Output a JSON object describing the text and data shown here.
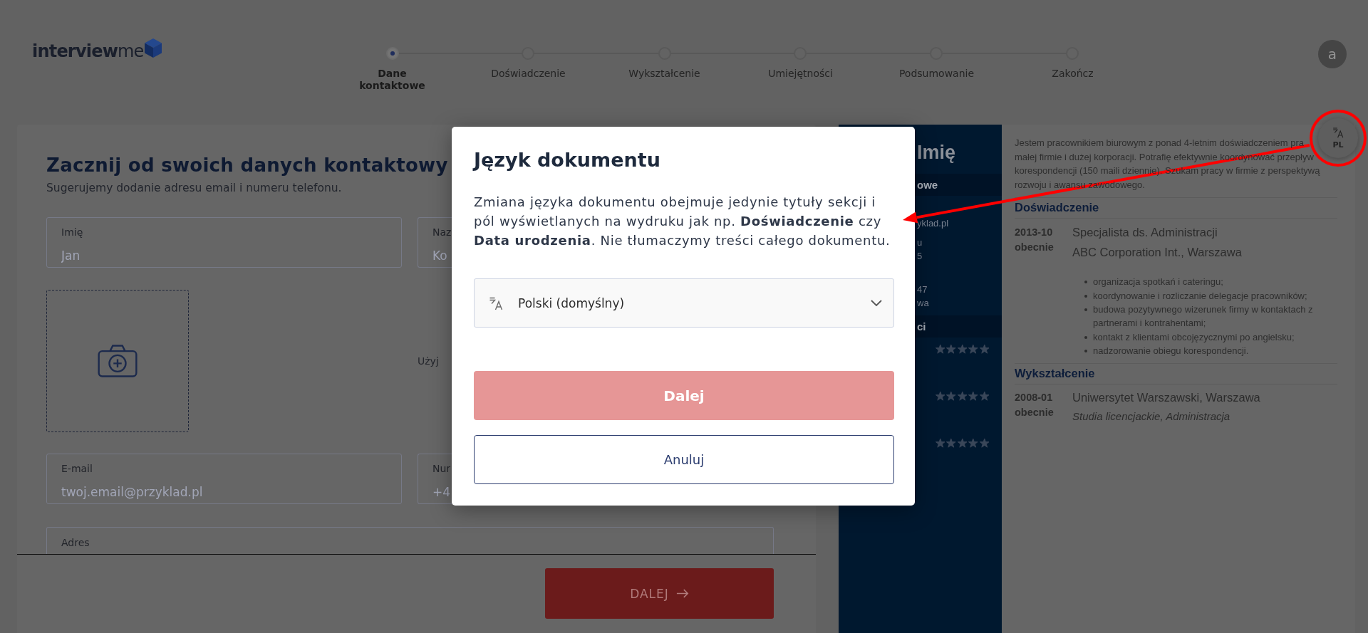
{
  "header": {
    "logo": "**interview**me",
    "steps": [
      {
        "label": "Dane kontaktowe",
        "selected": true
      },
      {
        "label": "Doświadczenie",
        "selected": false
      },
      {
        "label": "Wykształcenie",
        "selected": false
      },
      {
        "label": "Umiejętności",
        "selected": false
      },
      {
        "label": "Podsumowanie",
        "selected": false
      },
      {
        "label": "Zakończ",
        "selected": false
      }
    ],
    "avatar": "a"
  },
  "form": {
    "title": "Zacznij od swoich danych kontaktowy",
    "subtitle": "Sugerujemy dodanie adresu email i numeru telefonu.",
    "name_fields": [
      {
        "label": "Imię",
        "placeholder": "Jan"
      },
      {
        "label": "Naz",
        "placeholder": "Ko"
      }
    ],
    "photo_hint": "Użyj",
    "contact_fields": [
      {
        "label": "E-mail",
        "placeholder": "twoj.email@przyklad.pl"
      },
      {
        "label": "Nur",
        "placeholder": "+4"
      }
    ],
    "address_field": {
      "label": "Adres"
    },
    "next_button": {
      "label": "DALEJ"
    }
  },
  "cv_preview": {
    "sidebar": {
      "name": "Imię",
      "contact_heading": "owe",
      "contact_groups": [
        [
          "yklad.pl"
        ],
        [
          "u",
          "5"
        ],
        [
          "47",
          "wa"
        ]
      ],
      "skills_heading": "ci",
      "skills": [
        {
          "stars": 5
        },
        {
          "stars": 5
        },
        {
          "stars": 5
        }
      ]
    },
    "summary_lines": [
      "Jestem pracownikiem biurowym z ponad 4-letnim doświadczeniem pra",
      "małej firmie i dużej korporacji. Potrafię efektywnie koordynować przepływ",
      "korespondencji (150 maili dziennie). Szukam pracy w firmie z perspektywą",
      "rozwoju i awansu zawodowego."
    ],
    "sections": [
      {
        "title": "Doświadczenie",
        "entries": [
          {
            "kind": "job",
            "start": "2013-10",
            "end": "obecnie",
            "title": "Specjalista ds. Administracji",
            "subtitle": "ABC Corporation Int., Warszawa",
            "bullets": [
              "organizacja spotkań i cateringu;",
              "koordynowanie i rozliczanie delegacje pracowników;",
              "budowa pozytywnego wizerunek firmy w kontaktach z partnerami i kontrahentami;",
              "kontakt z klientami obcojęzycznymi po angielsku;",
              "nadzorowanie obiegu korespondencji."
            ]
          }
        ]
      },
      {
        "title": "Wykształcenie",
        "entries": [
          {
            "kind": "school",
            "start": "2008-01",
            "end": "obecnie",
            "title": "Uniwersytet Warszawski, Warszawa",
            "subtitle": "Studia licencjackie, Administracja"
          }
        ]
      }
    ]
  },
  "language_button": {
    "label": "PL"
  },
  "modal": {
    "title": "Język dokumentu",
    "text": "Zmiana języka dokumentu obejmuje jedynie tytuły sekcji i pól wyświetlanych na wydruku jak np. **Doświadczenie** czy **Data urodzenia**. Nie tłumaczymy treści całego dokumentu.",
    "language_select": {
      "value": "Polski (domyślny)"
    },
    "buttons": [
      {
        "kind": "primary",
        "label": "Dalej",
        "disabled": true
      },
      {
        "kind": "secondary",
        "label": "Anuluj",
        "disabled": false
      }
    ]
  }
}
